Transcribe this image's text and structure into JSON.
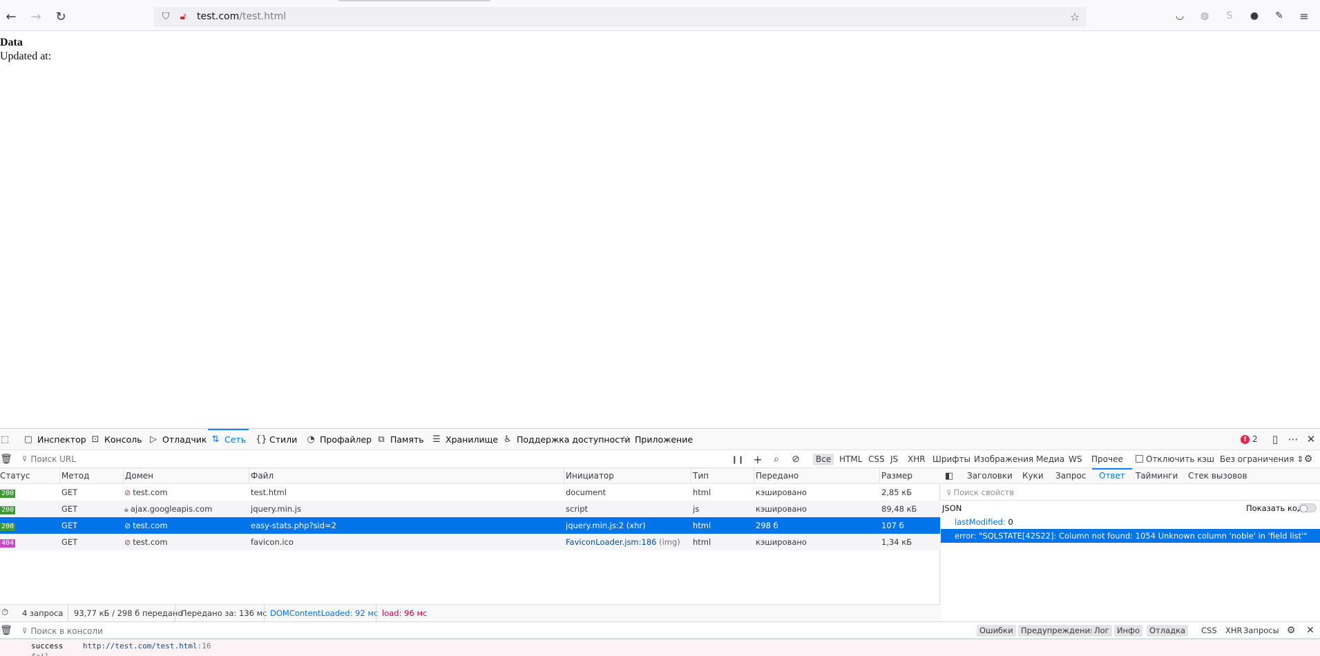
{
  "browser": {
    "url_host": "test.com",
    "url_path": "/test.html"
  },
  "page": {
    "heading": "Data",
    "updated_label": "Updated at:"
  },
  "devtools": {
    "tabs": [
      {
        "label": "Инспектор",
        "icon": "inspector-icon"
      },
      {
        "label": "Консоль",
        "icon": "console-icon"
      },
      {
        "label": "Отладчик",
        "icon": "debugger-icon"
      },
      {
        "label": "Сеть",
        "icon": "network-icon"
      },
      {
        "label": "Стили",
        "icon": "style-editor-icon"
      },
      {
        "label": "Профайлер",
        "icon": "performance-icon"
      },
      {
        "label": "Память",
        "icon": "memory-icon"
      },
      {
        "label": "Хранилище",
        "icon": "storage-icon"
      },
      {
        "label": "Поддержка доступности",
        "icon": "accessibility-icon"
      },
      {
        "label": "Приложение",
        "icon": "application-icon"
      }
    ],
    "active_tab": "Сеть",
    "error_count": "2",
    "network": {
      "filter_placeholder": "Поиск URL",
      "types": [
        "Все",
        "HTML",
        "CSS",
        "JS",
        "XHR",
        "Шрифты",
        "Изображения",
        "Медиа",
        "WS",
        "Прочее"
      ],
      "disable_cache_label": "Отключить кэш",
      "throttling_label": "Без ограничения ⇕",
      "columns": [
        "Статус",
        "Метод",
        "Домен",
        "Файл",
        "Инициатор",
        "Тип",
        "Передано",
        "Размер"
      ],
      "rows": [
        {
          "status": "200",
          "method": "GET",
          "domain": "test.com",
          "file": "test.html",
          "initiator": "document",
          "initiator_extra": "",
          "type": "html",
          "transferred": "кэшировано",
          "size": "2,85 кБ"
        },
        {
          "status": "200",
          "method": "GET",
          "domain": "ajax.googleapis.com",
          "file": "jquery.min.js",
          "initiator": "script",
          "initiator_extra": "",
          "type": "js",
          "transferred": "кэшировано",
          "size": "89,48 кБ"
        },
        {
          "status": "200",
          "method": "GET",
          "domain": "test.com",
          "file": "easy-stats.php?sid=2",
          "initiator": "jquery.min.js:2",
          "initiator_extra": " (xhr)",
          "type": "html",
          "transferred": "298 б",
          "size": "107 б"
        },
        {
          "status": "404",
          "method": "GET",
          "domain": "test.com",
          "file": "favicon.ico",
          "initiator": "FaviconLoader.jsm:186",
          "initiator_extra": " (img)",
          "type": "html",
          "transferred": "кэшировано",
          "size": "1,34 кБ"
        }
      ],
      "summary": {
        "requests": "4 запроса",
        "transferred": "93,77 кБ / 298 б передано",
        "finish": "Передано за: 136 мс",
        "dom_loaded": "DOMContentLoaded: 92 мс",
        "load": "load: 96 мс"
      }
    },
    "details": {
      "tabs": [
        "Заголовки",
        "Куки",
        "Запрос",
        "Ответ",
        "Тайминги",
        "Стек вызовов"
      ],
      "active_tab": "Ответ",
      "filter_placeholder": "Поиск свойств",
      "json_label": "JSON",
      "raw_toggle_label": "Показать код",
      "json": [
        {
          "key": "lastModified:",
          "value": " 0"
        },
        {
          "key": "error:",
          "value": " \"SQLSTATE[42S22]: Column not found: 1054 Unknown column 'noble' in 'field list'\""
        }
      ]
    },
    "console": {
      "filter_placeholder": "Поиск в консоли",
      "levels": [
        "Ошибки",
        "Предупреждения",
        "Лог",
        "Инфо",
        "Отладка"
      ],
      "extra": [
        "CSS",
        "XHR",
        "Запросы"
      ],
      "log_message": "success",
      "log_source": "http://test.com/test.html",
      "log_line": ":16",
      "log_next": "fail"
    }
  },
  "colors": {
    "accent": "#0074e8",
    "status_ok": "#3d9a34",
    "status_404": "#c648c9"
  }
}
